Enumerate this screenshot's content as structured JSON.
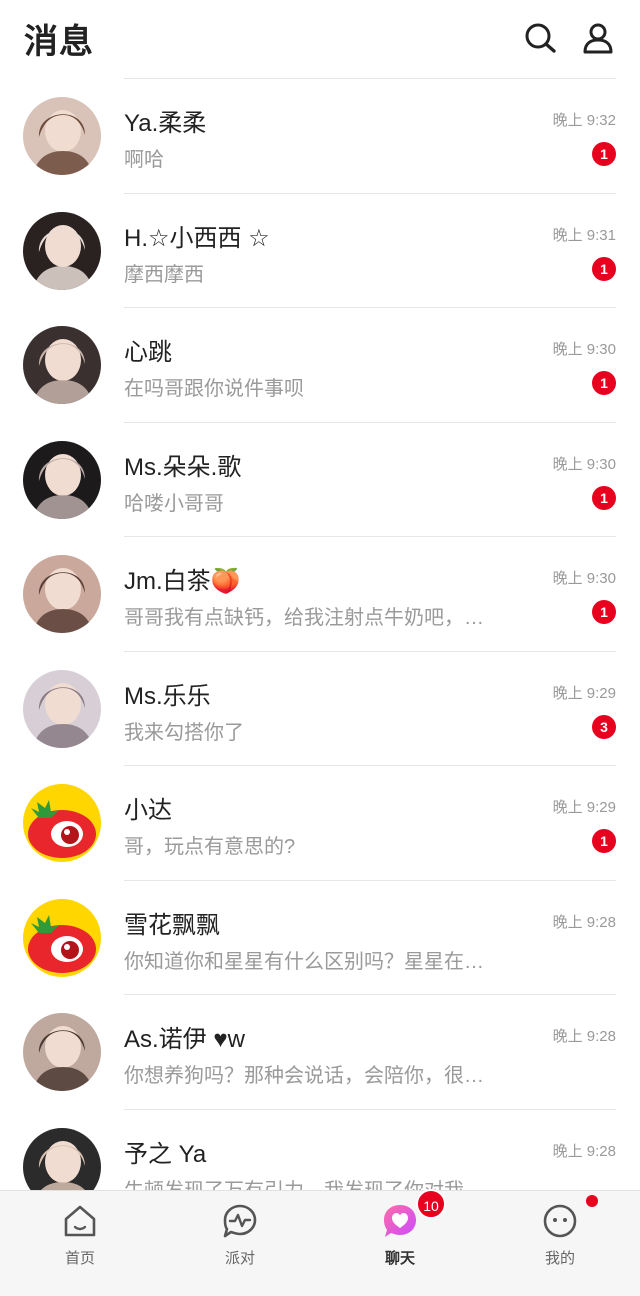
{
  "header": {
    "title": "消息",
    "search_icon": "search-icon",
    "user_icon": "user-icon"
  },
  "conversations": [
    {
      "name": "Ya.柔柔",
      "preview": "啊哈",
      "time": "晚上 9:32",
      "unread": "1",
      "avatar_colors": [
        "#d9c2b8",
        "#6b4a3a"
      ]
    },
    {
      "name": "H.☆小西西 ☆",
      "preview": "摩西摩西",
      "time": "晚上 9:31",
      "unread": "1",
      "avatar_colors": [
        "#2a2220",
        "#e7ddd6"
      ]
    },
    {
      "name": "心跳",
      "preview": "在吗哥跟你说件事呗",
      "time": "晚上 9:30",
      "unread": "1",
      "avatar_colors": [
        "#3a3030",
        "#c7b3aa"
      ]
    },
    {
      "name": "Ms.朵朵.歌",
      "preview": "哈喽小哥哥",
      "time": "晚上 9:30",
      "unread": "1",
      "avatar_colors": [
        "#1d1a1c",
        "#b8a9a6"
      ]
    },
    {
      "name": "Jm.白茶🍑",
      "preview": "哥哥我有点缺钙，给我注射点牛奶吧，…",
      "time": "晚上 9:30",
      "unread": "1",
      "avatar_colors": [
        "#caa89b",
        "#5a3f38"
      ]
    },
    {
      "name": "Ms.乐乐",
      "preview": "我来勾搭你了",
      "time": "晚上 9:29",
      "unread": "3",
      "avatar_colors": [
        "#d8cfd6",
        "#8a7a84"
      ]
    },
    {
      "name": "小达",
      "preview": "哥，玩点有意思的?",
      "time": "晚上 9:29",
      "unread": "1",
      "avatar_colors": [
        "tomato"
      ]
    },
    {
      "name": "雪花飘飘",
      "preview": "你知道你和星星有什么区别吗？星星在…",
      "time": "晚上 9:28",
      "unread": "",
      "avatar_colors": [
        "tomato"
      ]
    },
    {
      "name": "As.诺伊 ♥w",
      "preview": "你想养狗吗？那种会说话，会陪你，很…",
      "time": "晚上 9:28",
      "unread": "",
      "avatar_colors": [
        "#bfa89e",
        "#4a3a33"
      ]
    },
    {
      "name": "予之 Ya",
      "preview": "牛顿发现了万有引力，我发现了你对我…",
      "time": "晚上 9:28",
      "unread": "",
      "avatar_colors": [
        "#2b2b2b",
        "#d8c1b2"
      ]
    }
  ],
  "tabbar": {
    "tabs": [
      {
        "label": "首页",
        "icon": "home-icon"
      },
      {
        "label": "派对",
        "icon": "party-icon"
      },
      {
        "label": "聊天",
        "icon": "chat-heart-icon",
        "badge": "10"
      },
      {
        "label": "我的",
        "icon": "profile-face-icon",
        "dot": true
      }
    ]
  },
  "colors": {
    "accent_red": "#e8001f",
    "chat_gradient_start": "#ff6aa8",
    "chat_gradient_end": "#c94dff"
  }
}
